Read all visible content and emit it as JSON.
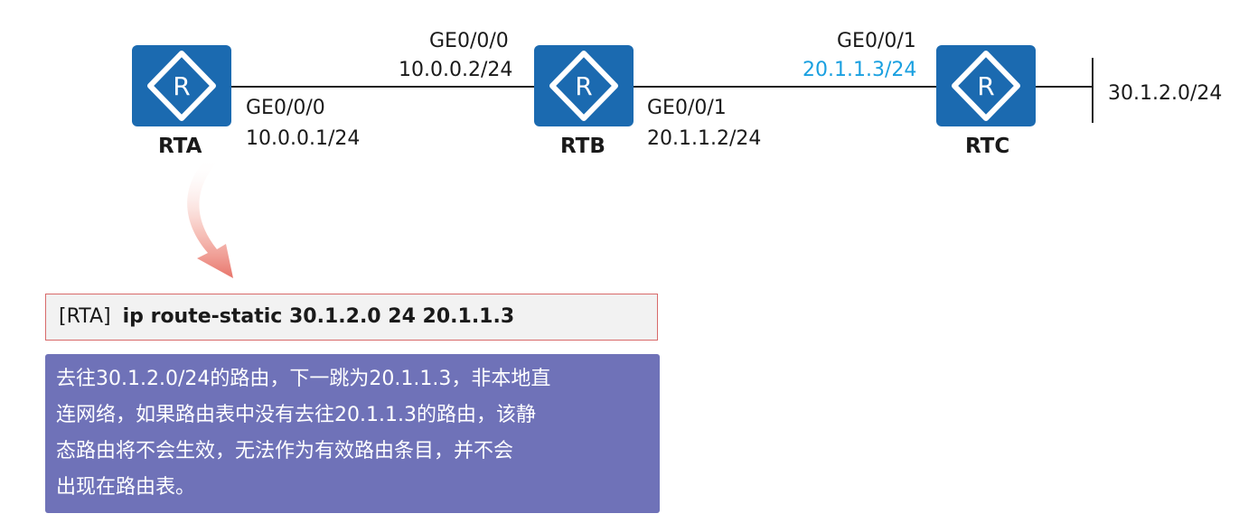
{
  "routers": {
    "rta": {
      "name": "RTA",
      "icon": "router-icon"
    },
    "rtb": {
      "name": "RTB",
      "icon": "router-icon"
    },
    "rtc": {
      "name": "RTC",
      "icon": "router-icon"
    }
  },
  "interfaces": {
    "rta_if": "GE0/0/0",
    "rta_ip": "10.0.0.1/24",
    "rtb_if_left": "GE0/0/0",
    "rtb_ip_left": "10.0.0.2/24",
    "rtb_if_right": "GE0/0/1",
    "rtb_ip_right": "20.1.1.2/24",
    "rtc_if": "GE0/0/1",
    "rtc_ip": "20.1.1.3/24"
  },
  "network": "30.1.2.0/24",
  "command": {
    "prompt": "[RTA]",
    "text": "ip route-static 30.1.2.0 24 20.1.1.3"
  },
  "note": "去往30.1.2.0/24的路由，下一跳为20.1.1.3，非本地直\n连网络，如果路由表中没有去往20.1.1.3的路由，该静\n态路由将不会生效，无法作为有效路由条目，并不会\n出现在路由表。",
  "colors": {
    "router_fill": "#1b6ab0",
    "highlight_ip": "#1aa0e0",
    "note_bg": "#6f72b8",
    "arrow": "#e8756b"
  }
}
